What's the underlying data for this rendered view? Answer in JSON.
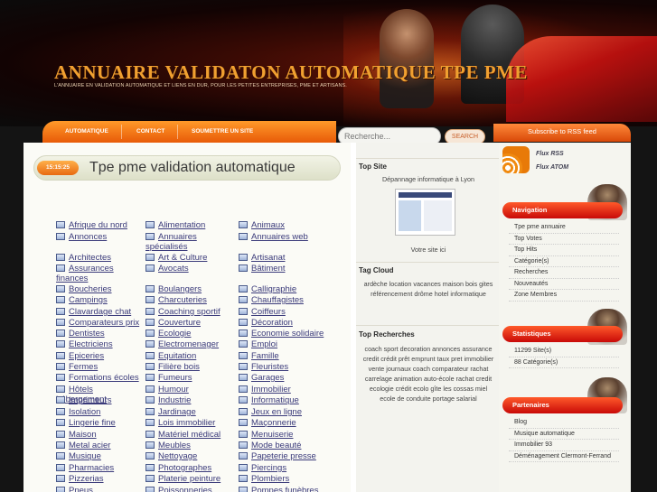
{
  "header": {
    "site_title": "ANNUAIRE VALIDATON AUTOMATIQUE TPE PME",
    "tagline": "L'ANNUAIRE EN VALIDATION AUTOMATIQUE ET LIENS EN DUR, POUR LES PETITES ENTREPRISES, PME ET ARTISANS."
  },
  "nav": {
    "items": [
      "AUTOMATIQUE",
      "CONTACT",
      "SOUMETTRE UN SITE"
    ]
  },
  "search": {
    "placeholder": "Recherche...",
    "button_label": "SEARCH"
  },
  "rss_top": "Subscribe to RSS feed",
  "main": {
    "time": "15:15:25",
    "title": "Tpe pme validation automatique",
    "categories_col1": [
      "Afrique du nord",
      "Annonces",
      "Architectes",
      "Assurances finances",
      "Boucheries",
      "Campings",
      "Clavardage chat",
      "Comparateurs prix",
      "Dentistes",
      "Electriciens",
      "Epiceries",
      "Fermes",
      "Formations écoles",
      "Hôtels hébergement",
      "Imprimeurs",
      "Isolation",
      "Lingerie fine",
      "Maison",
      "Metal acier",
      "Musique",
      "Pharmacies",
      "Pizzerias",
      "Pneus"
    ],
    "categories_col2": [
      "Alimentation",
      "Annuaires spécialisés",
      "Art & Culture",
      "Avocats",
      "Boulangers",
      "Charcuteries",
      "Coaching sportif",
      "Couverture",
      "Ecologie",
      "Electromenager",
      "Equitation",
      "Filière bois",
      "Fumeurs",
      "Humour",
      "Industrie",
      "Jardinage",
      "Lois immobilier",
      "Matériel médical",
      "Meubles",
      "Nettoyage",
      "Photographes",
      "Platerie peinture",
      "Poissonneries"
    ],
    "categories_col3": [
      "Animaux",
      "Annuaires web",
      "Artisanat",
      "Bâtiment",
      "Calligraphie",
      "Chauffagistes",
      "Coiffeurs",
      "Décoration",
      "Economie solidaire",
      "Emploi",
      "Famille",
      "Fleuristes",
      "Garages",
      "Immobilier",
      "Informatique",
      "Jeux en ligne",
      "Maçonnerie",
      "Menuiserie",
      "Mode beauté",
      "Papeterie presse",
      "Piercings",
      "Plombiers",
      "Pompes funèbres"
    ]
  },
  "middle": {
    "top_site_heading": "Top Site",
    "top_site_link": "Dépannage informatique à Lyon",
    "your_site": "Votre site ici",
    "tag_cloud_heading": "Tag Cloud",
    "tag_cloud_text": "ardèche location vacances maison bois gites référencement drôme hotel informatique",
    "top_searches_heading": "Top Recherches",
    "top_searches_text": "coach sport decoration annonces assurance credit crédit prêt emprunt taux pret immobilier vente journaux coach comparateur rachat carrelage animation auto-école rachat credit ecologie crédit ecolo gîte les cossas miel ecole de conduite portage salarial"
  },
  "right": {
    "flux_rss": "Flux RSS",
    "flux_atom": "Flux ATOM",
    "navigation_heading": "Navigation",
    "navigation_items": [
      "Tpe pme annuaire",
      "Top Votes",
      "Top Hits",
      "Catégorie(s)",
      "Recherches",
      "Nouveautés",
      "Zone Membres"
    ],
    "stats_heading": "Statistiques",
    "stats_items": [
      "11299 Site(s)",
      "88 Catégorie(s)"
    ],
    "partners_heading": "Partenaires",
    "partners_items": [
      "Blog",
      "Musique automatique",
      "Immobilier 93",
      "Déménagement Clermont-Ferrand"
    ]
  },
  "colors": {
    "accent_orange": "#e86a10",
    "pill_red": "#c80a08",
    "title_gold": "#f0a030",
    "link_blue": "#3a3a7a"
  }
}
